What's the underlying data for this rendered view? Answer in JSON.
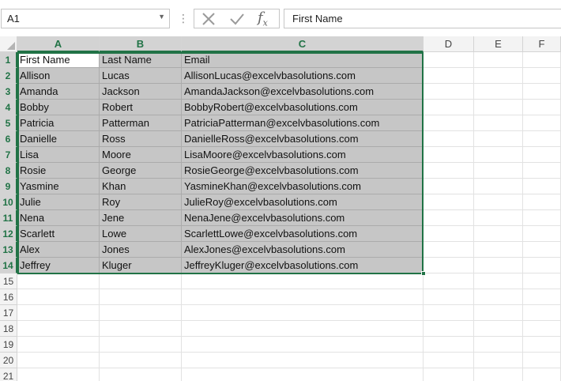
{
  "formula_bar": {
    "name_box": "A1",
    "formula": "First Name"
  },
  "columns": [
    "A",
    "B",
    "C",
    "D",
    "E",
    "F"
  ],
  "rows": [
    "1",
    "2",
    "3",
    "4",
    "5",
    "6",
    "7",
    "8",
    "9",
    "10",
    "11",
    "12",
    "13",
    "14",
    "15",
    "16",
    "17",
    "18",
    "19",
    "20",
    "21"
  ],
  "table": [
    [
      "First Name",
      "Last Name",
      "Email"
    ],
    [
      "Allison",
      "Lucas",
      "AllisonLucas@excelvbasolutions.com"
    ],
    [
      "Amanda",
      "Jackson",
      "AmandaJackson@excelvbasolutions.com"
    ],
    [
      "Bobby",
      "Robert",
      "BobbyRobert@excelvbasolutions.com"
    ],
    [
      "Patricia",
      "Patterman",
      "PatriciaPatterman@excelvbasolutions.com"
    ],
    [
      "Danielle",
      "Ross",
      "DanielleRoss@excelvbasolutions.com"
    ],
    [
      "Lisa",
      "Moore",
      "LisaMoore@excelvbasolutions.com"
    ],
    [
      "Rosie",
      "George",
      "RosieGeorge@excelvbasolutions.com"
    ],
    [
      "Yasmine",
      "Khan",
      "YasmineKhan@excelvbasolutions.com"
    ],
    [
      "Julie",
      "Roy",
      "JulieRoy@excelvbasolutions.com"
    ],
    [
      "Nena",
      "Jene",
      "NenaJene@excelvbasolutions.com"
    ],
    [
      "Scarlett",
      "Lowe",
      "ScarlettLowe@excelvbasolutions.com"
    ],
    [
      "Alex",
      "Jones",
      "AlexJones@excelvbasolutions.com"
    ],
    [
      "Jeffrey",
      "Kluger",
      "JeffreyKluger@excelvbasolutions.com"
    ]
  ],
  "colors": {
    "selection_accent": "#217346",
    "selection_fill": "#c6c6c6",
    "header_bg": "#f3f3f3"
  }
}
